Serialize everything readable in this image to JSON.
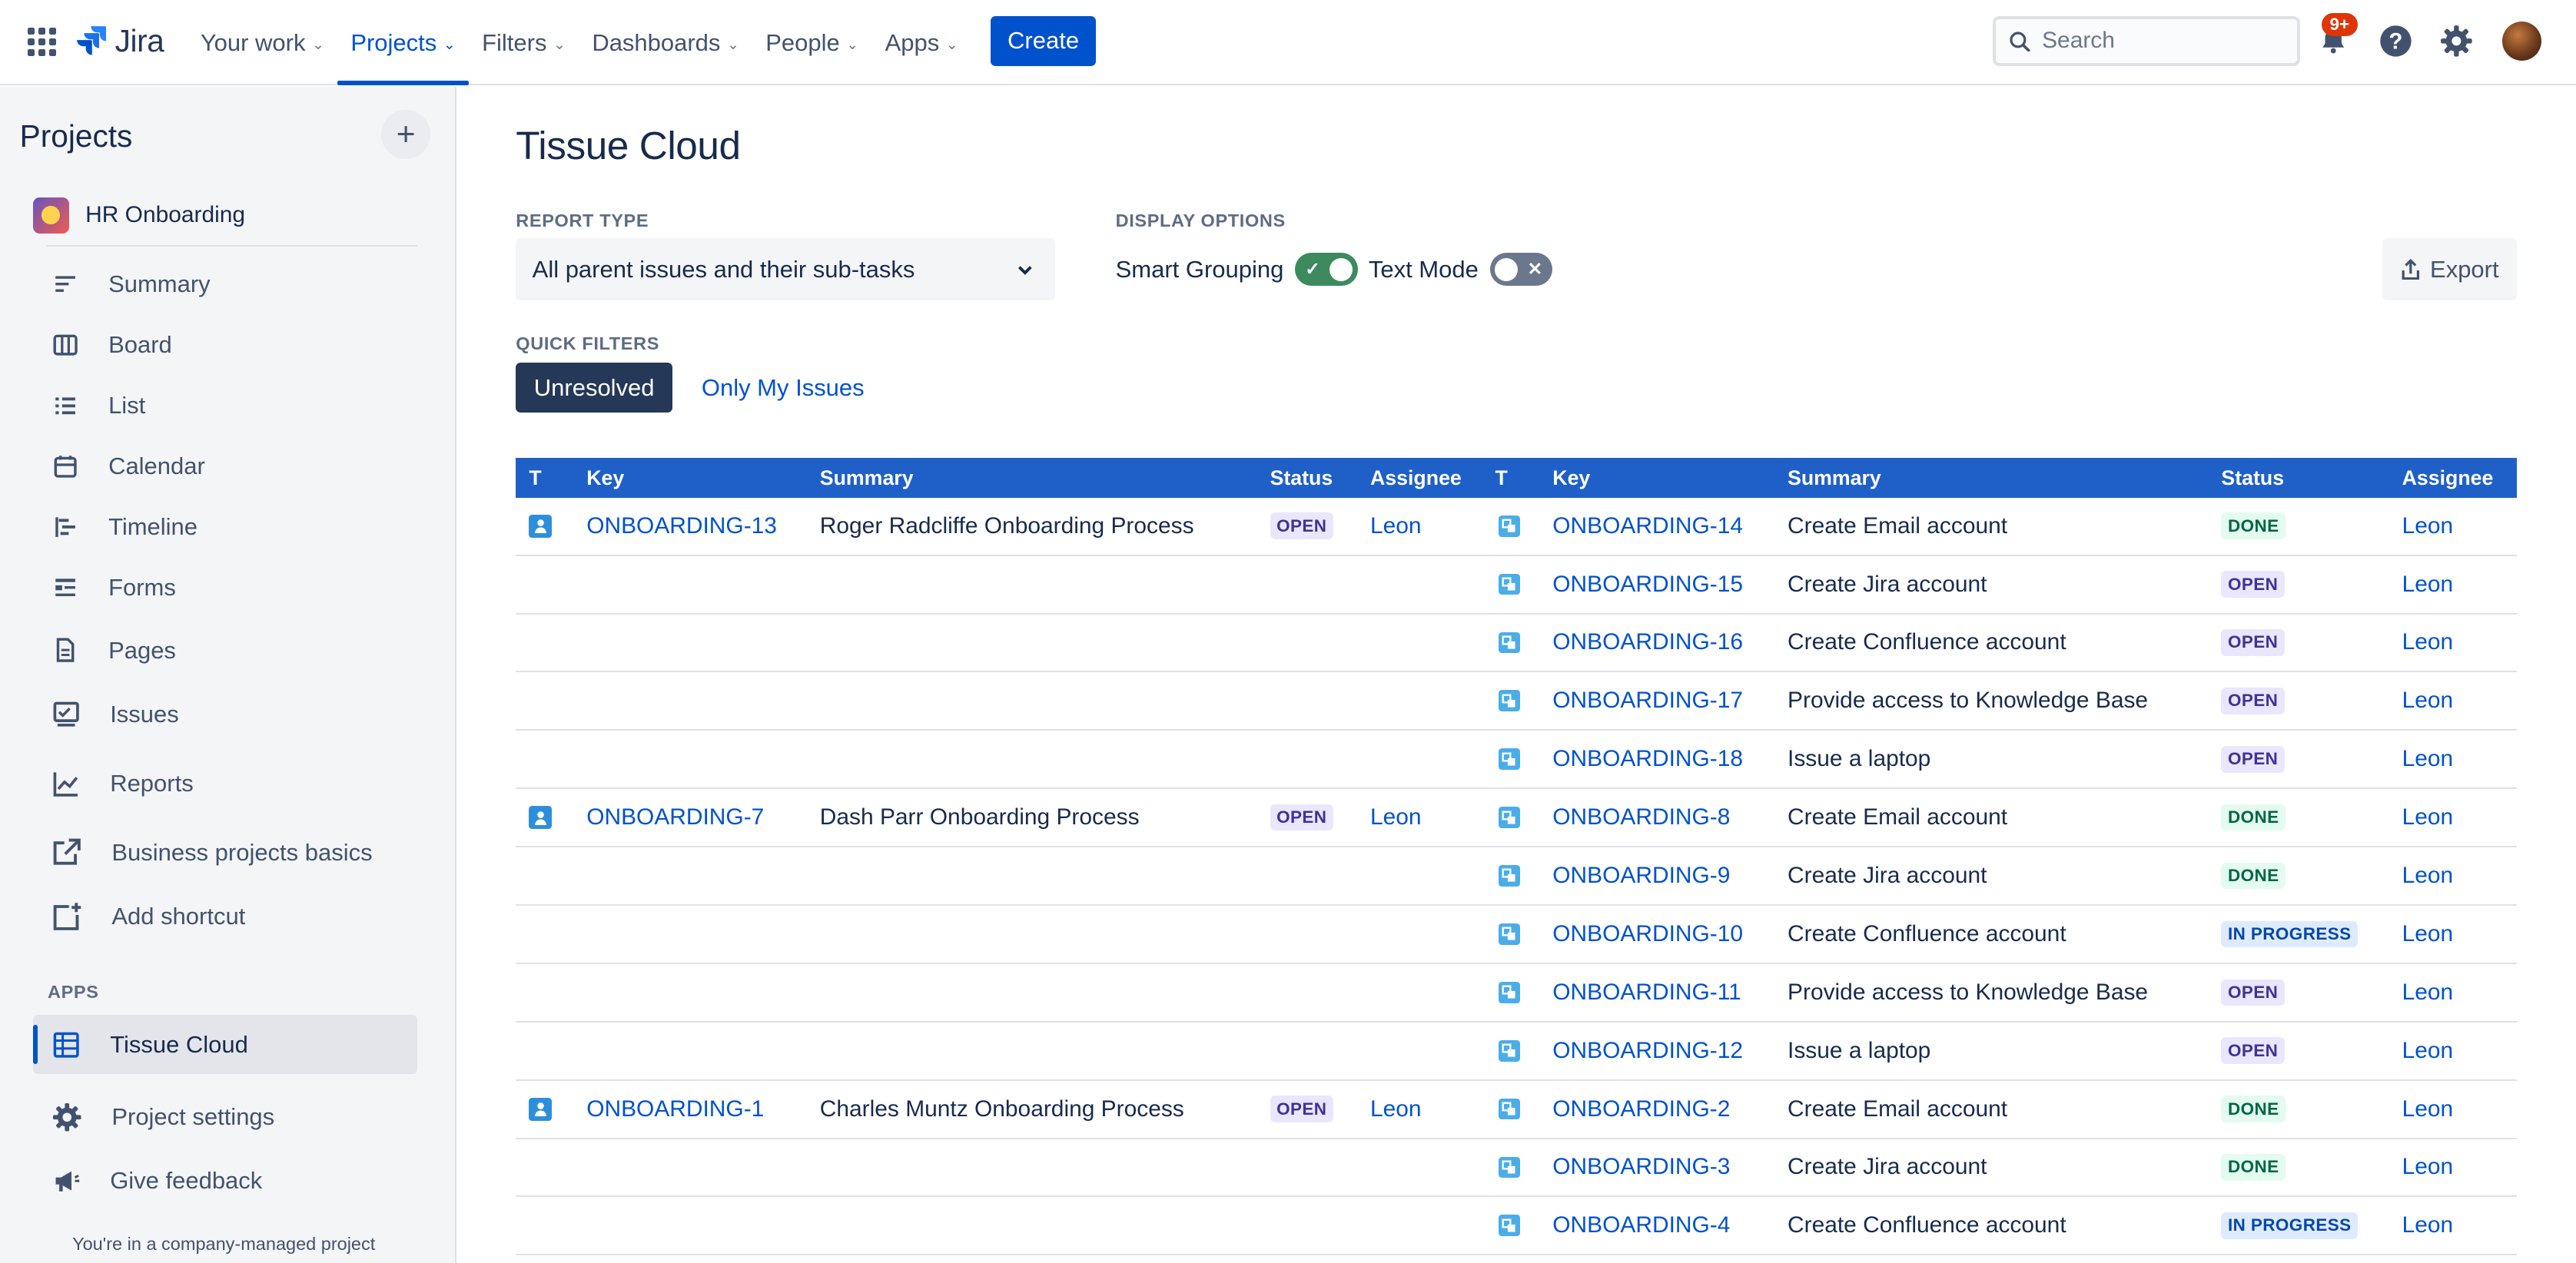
{
  "topnav": {
    "logo": "Jira",
    "items": [
      {
        "label": "Your work"
      },
      {
        "label": "Projects"
      },
      {
        "label": "Filters"
      },
      {
        "label": "Dashboards"
      },
      {
        "label": "People"
      },
      {
        "label": "Apps"
      }
    ],
    "create": "Create",
    "search_placeholder": "Search",
    "notif_badge": "9+"
  },
  "sidebar": {
    "title": "Projects",
    "project": "HR Onboarding",
    "items": [
      {
        "label": "Summary"
      },
      {
        "label": "Board"
      },
      {
        "label": "List"
      },
      {
        "label": "Calendar"
      },
      {
        "label": "Timeline"
      },
      {
        "label": "Forms"
      },
      {
        "label": "Pages"
      },
      {
        "label": "Issues"
      },
      {
        "label": "Reports"
      },
      {
        "label": "Business projects basics"
      },
      {
        "label": "Add shortcut"
      }
    ],
    "apps_heading": "APPS",
    "app_item": "Tissue Cloud",
    "settings": "Project settings",
    "feedback": "Give feedback",
    "footer": "You're in a company-managed project"
  },
  "main": {
    "title": "Tissue Cloud",
    "report_type_label": "REPORT TYPE",
    "report_type_value": "All parent issues and their sub-tasks",
    "display_options_label": "DISPLAY OPTIONS",
    "smart_grouping": "Smart Grouping",
    "text_mode": "Text Mode",
    "export": "Export",
    "quick_filters_label": "QUICK FILTERS",
    "qf_unresolved": "Unresolved",
    "qf_only_mine": "Only My Issues"
  },
  "table": {
    "headers": {
      "t": "T",
      "key": "Key",
      "summary": "Summary",
      "status": "Status",
      "assignee": "Assignee"
    },
    "rows": [
      {
        "pkey": "ONBOARDING-13",
        "psum": "Roger Radcliffe Onboarding Process",
        "pstatus": "OPEN",
        "passg": "Leon",
        "ckey": "ONBOARDING-14",
        "csum": "Create Email account",
        "cstatus": "DONE",
        "cassg": "Leon"
      },
      {
        "pkey": "",
        "psum": "",
        "pstatus": "",
        "passg": "",
        "ckey": "ONBOARDING-15",
        "csum": "Create Jira account",
        "cstatus": "OPEN",
        "cassg": "Leon"
      },
      {
        "pkey": "",
        "psum": "",
        "pstatus": "",
        "passg": "",
        "ckey": "ONBOARDING-16",
        "csum": "Create Confluence account",
        "cstatus": "OPEN",
        "cassg": "Leon"
      },
      {
        "pkey": "",
        "psum": "",
        "pstatus": "",
        "passg": "",
        "ckey": "ONBOARDING-17",
        "csum": "Provide access to Knowledge Base",
        "cstatus": "OPEN",
        "cassg": "Leon"
      },
      {
        "pkey": "",
        "psum": "",
        "pstatus": "",
        "passg": "",
        "ckey": "ONBOARDING-18",
        "csum": "Issue a laptop",
        "cstatus": "OPEN",
        "cassg": "Leon"
      },
      {
        "pkey": "ONBOARDING-7",
        "psum": "Dash Parr Onboarding Process",
        "pstatus": "OPEN",
        "passg": "Leon",
        "ckey": "ONBOARDING-8",
        "csum": "Create Email account",
        "cstatus": "DONE",
        "cassg": "Leon"
      },
      {
        "pkey": "",
        "psum": "",
        "pstatus": "",
        "passg": "",
        "ckey": "ONBOARDING-9",
        "csum": "Create Jira account",
        "cstatus": "DONE",
        "cassg": "Leon"
      },
      {
        "pkey": "",
        "psum": "",
        "pstatus": "",
        "passg": "",
        "ckey": "ONBOARDING-10",
        "csum": "Create Confluence account",
        "cstatus": "IN PROGRESS",
        "cassg": "Leon"
      },
      {
        "pkey": "",
        "psum": "",
        "pstatus": "",
        "passg": "",
        "ckey": "ONBOARDING-11",
        "csum": "Provide access to Knowledge Base",
        "cstatus": "OPEN",
        "cassg": "Leon"
      },
      {
        "pkey": "",
        "psum": "",
        "pstatus": "",
        "passg": "",
        "ckey": "ONBOARDING-12",
        "csum": "Issue a laptop",
        "cstatus": "OPEN",
        "cassg": "Leon"
      },
      {
        "pkey": "ONBOARDING-1",
        "psum": "Charles Muntz Onboarding Process",
        "pstatus": "OPEN",
        "passg": "Leon",
        "ckey": "ONBOARDING-2",
        "csum": "Create Email account",
        "cstatus": "DONE",
        "cassg": "Leon"
      },
      {
        "pkey": "",
        "psum": "",
        "pstatus": "",
        "passg": "",
        "ckey": "ONBOARDING-3",
        "csum": "Create Jira account",
        "cstatus": "DONE",
        "cassg": "Leon"
      },
      {
        "pkey": "",
        "psum": "",
        "pstatus": "",
        "passg": "",
        "ckey": "ONBOARDING-4",
        "csum": "Create Confluence account",
        "cstatus": "IN PROGRESS",
        "cassg": "Leon"
      }
    ]
  },
  "colors": {
    "brand": "#0052cc",
    "header": "#1f5fc8",
    "done": "#006644",
    "open": "#403294",
    "in_progress": "#0747a6"
  }
}
